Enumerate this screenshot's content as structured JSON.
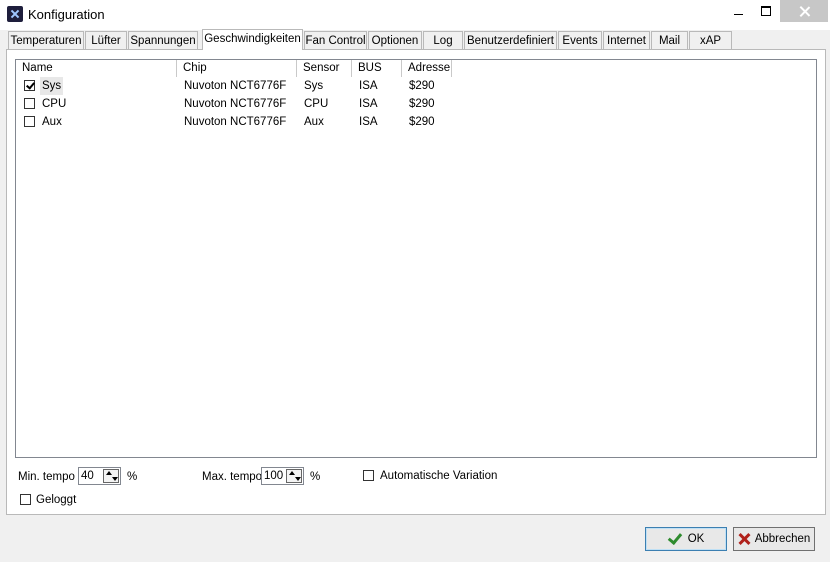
{
  "window": {
    "title": "Konfiguration"
  },
  "tabs": [
    {
      "label": "Temperaturen"
    },
    {
      "label": "Lüfter"
    },
    {
      "label": "Spannungen"
    },
    {
      "label": "Geschwindigkeiten"
    },
    {
      "label": "Fan Control"
    },
    {
      "label": "Optionen"
    },
    {
      "label": "Log"
    },
    {
      "label": "Benutzerdefiniert"
    },
    {
      "label": "Events"
    },
    {
      "label": "Internet"
    },
    {
      "label": "Mail"
    },
    {
      "label": "xAP"
    }
  ],
  "active_tab": "Geschwindigkeiten",
  "list": {
    "columns": [
      "Name",
      "Chip",
      "Sensor",
      "BUS",
      "Adresse"
    ],
    "rows": [
      {
        "checked": true,
        "name": "Sys",
        "chip": "Nuvoton NCT6776F",
        "sensor": "Sys",
        "bus": "ISA",
        "address": "$290"
      },
      {
        "checked": false,
        "name": "CPU",
        "chip": "Nuvoton NCT6776F",
        "sensor": "CPU",
        "bus": "ISA",
        "address": "$290"
      },
      {
        "checked": false,
        "name": "Aux",
        "chip": "Nuvoton NCT6776F",
        "sensor": "Aux",
        "bus": "ISA",
        "address": "$290"
      }
    ]
  },
  "settings": {
    "min_label": "Min. tempo",
    "min_value": "40",
    "min_unit": "%",
    "max_label": "Max. tempo",
    "max_value": "100",
    "max_unit": "%",
    "auto_variation_label": "Automatische Variation",
    "auto_variation_checked": false,
    "logged_label": "Geloggt",
    "logged_checked": false
  },
  "buttons": {
    "ok": "OK",
    "cancel": "Abbrechen"
  },
  "colors": {
    "ok_icon": "#2e8b2e",
    "cancel_icon": "#b0201a"
  }
}
